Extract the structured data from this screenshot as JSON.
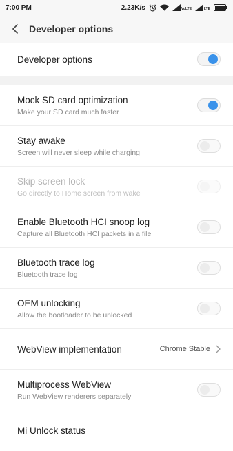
{
  "status_bar": {
    "time": "7:00 PM",
    "net_speed": "2.23K/s",
    "icons": [
      "alarm-icon",
      "wifi-icon",
      "signal-volte-icon",
      "signal-lte-icon",
      "battery-icon"
    ],
    "volte_label": "VoLTE",
    "lte_label": "LTE"
  },
  "header": {
    "title": "Developer options"
  },
  "master": {
    "label": "Developer options",
    "on": true
  },
  "settings": [
    {
      "label": "Mock SD card optimization",
      "sub": "Make your SD card much faster",
      "on": true,
      "enabled": true
    },
    {
      "label": "Stay awake",
      "sub": "Screen will never sleep while charging",
      "on": false,
      "enabled": true
    },
    {
      "label": "Skip screen lock",
      "sub": "Go directly to Home screen from wake",
      "on": false,
      "enabled": false
    },
    {
      "label": "Enable Bluetooth HCI snoop log",
      "sub": "Capture all Bluetooth HCI packets in a file",
      "on": false,
      "enabled": true
    },
    {
      "label": "Bluetooth trace log",
      "sub": "Bluetooth trace log",
      "on": false,
      "enabled": true
    },
    {
      "label": "OEM unlocking",
      "sub": "Allow the bootloader to be unlocked",
      "on": false,
      "enabled": true
    },
    {
      "label": "WebView implementation",
      "value": "Chrome Stable"
    },
    {
      "label": "Multiprocess WebView",
      "sub": "Run WebView renderers separately",
      "on": false,
      "enabled": true
    },
    {
      "label": "Mi Unlock status"
    }
  ],
  "colors": {
    "accent": "#3a92ea",
    "background": "#f7f7f7"
  }
}
